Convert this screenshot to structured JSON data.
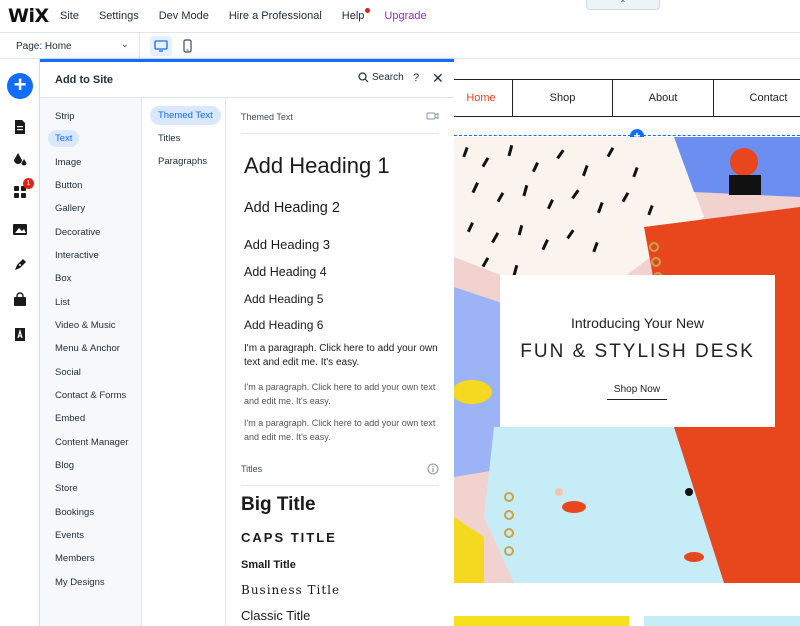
{
  "topbar": {
    "logo": "WiX",
    "menus": [
      "Site",
      "Settings",
      "Dev Mode",
      "Hire a Professional",
      "Help"
    ],
    "upgrade": "Upgrade",
    "collapse_glyph": "⌃"
  },
  "pagebar": {
    "page_label": "Page:",
    "page_value": "Home",
    "chevron": "⌄"
  },
  "rail": {
    "add_glyph": "+",
    "badge_count": "1",
    "icons": [
      "pages-icon",
      "theme-icon",
      "apps-icon",
      "media-icon",
      "blog-pen-icon",
      "store-bag-icon",
      "fonts-icon"
    ]
  },
  "panel": {
    "title": "Add to Site",
    "search_label": "Search",
    "help": "?",
    "close": "✕",
    "categories": [
      "Strip",
      "Text",
      "Image",
      "Button",
      "Gallery",
      "Decorative",
      "Interactive",
      "Box",
      "List",
      "Video & Music",
      "Menu & Anchor",
      "Social",
      "Contact & Forms",
      "Embed",
      "Content Manager",
      "Blog",
      "Store",
      "Bookings",
      "Events",
      "Members",
      "My Designs"
    ],
    "active_category": "Text",
    "subcategories": [
      "Themed Text",
      "Titles",
      "Paragraphs"
    ],
    "active_subcategory": "Themed Text",
    "themed_text": {
      "header": "Themed Text",
      "headings": [
        "Add Heading 1",
        "Add Heading 2",
        "Add Heading 3",
        "Add Heading 4",
        "Add Heading 5",
        "Add Heading 6"
      ],
      "paragraph1": "I'm a paragraph. Click here to add your own text and edit me. It's easy.",
      "paragraph2": "I'm a paragraph. Click here to add your own text and edit me. It's easy.",
      "paragraph3": "I'm a paragraph. Click here to add your own text and edit me. It's easy."
    },
    "titles": {
      "header": "Titles",
      "items": [
        "Big Title",
        "CAPS TITLE",
        "Small Title",
        "Business Title",
        "Classic Title"
      ]
    }
  },
  "site": {
    "nav": [
      "Home",
      "Shop",
      "About",
      "Contact"
    ],
    "active_nav_color": "#e8461c",
    "hero_line1": "Introducing Your New",
    "hero_line2": "FUN & STYLISH DESK",
    "hero_button": "Shop Now",
    "add_section_glyph": "+"
  },
  "colors": {
    "accent": "#116dff",
    "upgrade": "#9a27d5",
    "badge": "#e62214"
  }
}
